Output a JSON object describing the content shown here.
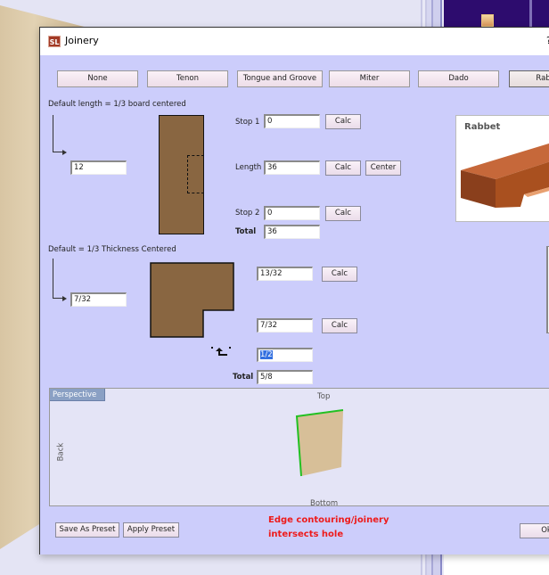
{
  "window": {
    "title": "Joinery",
    "app_icon": "SL",
    "help_label": "?"
  },
  "joinery_types": [
    {
      "label": "None",
      "selected": false
    },
    {
      "label": "Tenon",
      "selected": false
    },
    {
      "label": "Tongue and Groove",
      "selected": false
    },
    {
      "label": "Miter",
      "selected": false
    },
    {
      "label": "Dado",
      "selected": false
    },
    {
      "label": "Rabbet",
      "selected": true
    }
  ],
  "length_section": {
    "default_note": "Default length = 1/3 board centered",
    "offset_value": "12",
    "stop1_label": "Stop 1",
    "stop1_value": "0",
    "length_label": "Length",
    "length_value": "36",
    "stop2_label": "Stop 2",
    "stop2_value": "0",
    "total_label": "Total",
    "total_value": "36",
    "calc_label": "Calc",
    "center_label": "Center"
  },
  "thickness_section": {
    "default_note": "Default =  1/3 Thickness Centered",
    "offset_value": "7/32",
    "top_value": "13/32",
    "bottom_value": "7/32",
    "depth_value": "1/2",
    "total_label": "Total",
    "total_value": "5/8",
    "calc_label": "Calc"
  },
  "preview": {
    "title": "Rabbet"
  },
  "perspective": {
    "tab_label": "Perspective",
    "top_label": "Top",
    "bottom_label": "Bottom",
    "back_label": "Back"
  },
  "footer": {
    "save_preset_label": "Save As Preset",
    "apply_preset_label": "Apply Preset",
    "warning_line1": "Edge contouring/joinery",
    "warning_line2": "intersects hole",
    "ok_label": "Ok"
  }
}
